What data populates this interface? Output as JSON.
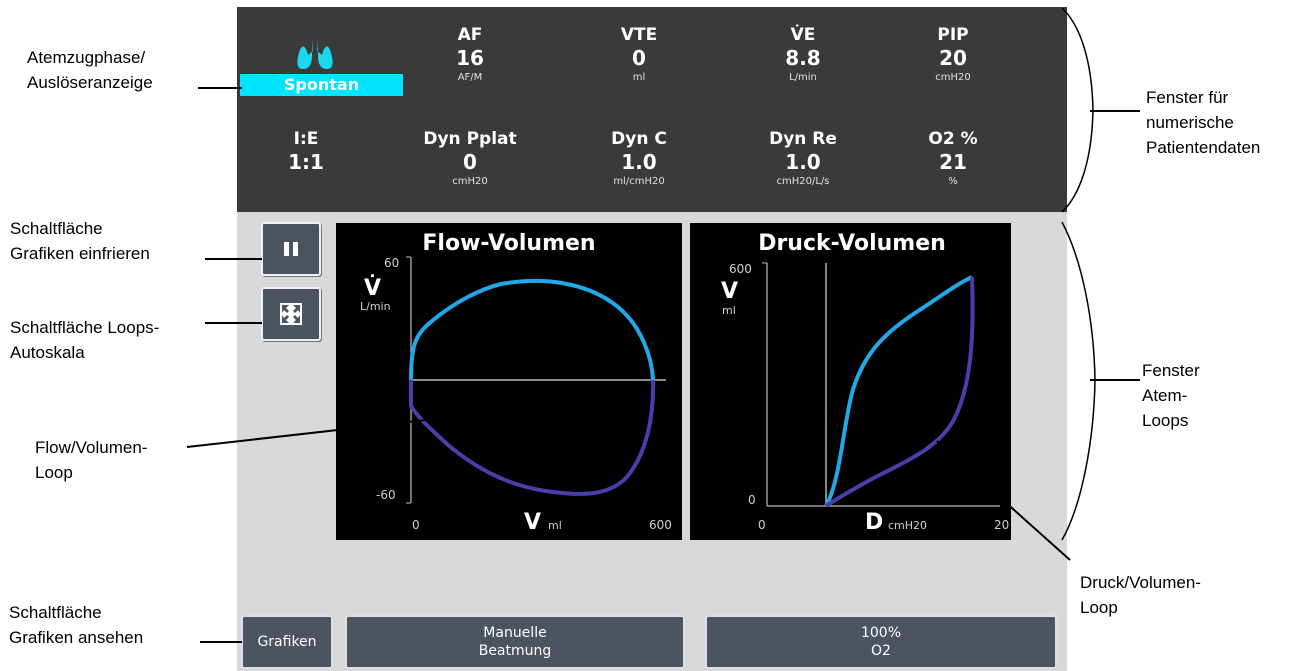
{
  "callouts": {
    "phase_indicator": "Atemzugphase/\nAuslöseranzeige",
    "patient_data_window": "Fenster für\nnumerische\nPatientendaten",
    "freeze_button": "Schaltfläche\nGrafiken einfrieren",
    "autoscale_button": "Schaltfläche Loops-\nAutoskala",
    "flow_volume_loop": "Flow/Volumen-\nLoop",
    "loops_window": "Fenster\nAtem-\nLoops",
    "pressure_volume_loop": "Druck/Volumen-\nLoop",
    "view_graphics_button": "Schaltfläche\nGrafiken ansehen"
  },
  "phase_label": "Spontan",
  "parameters_row1": [
    {
      "label": "AF",
      "value": "16",
      "unit": "AF/M"
    },
    {
      "label": "VTE",
      "value": "0",
      "unit": "ml"
    },
    {
      "label": "V̇E",
      "value": "8.8",
      "unit": "L/min"
    },
    {
      "label": "PIP",
      "value": "20",
      "unit": "cmH20"
    }
  ],
  "parameters_row2": [
    {
      "label": "I:E",
      "value": "1:1",
      "unit": ""
    },
    {
      "label": "Dyn Pplat",
      "value": "0",
      "unit": "cmH20"
    },
    {
      "label": "Dyn C",
      "value": "1.0",
      "unit": "ml/cmH20"
    },
    {
      "label": "Dyn Re",
      "value": "1.0",
      "unit": "cmH20/L/s"
    },
    {
      "label": "O2 %",
      "value": "21",
      "unit": "%"
    }
  ],
  "flow_volume": {
    "title": "Flow-Volumen",
    "y_symbol": "V̇",
    "y_unit": "L/min",
    "y_max": "60",
    "y_min": "-60",
    "x_symbol": "V",
    "x_unit": "ml",
    "x_min": "0",
    "x_max": "600"
  },
  "pressure_volume": {
    "title": "Druck-Volumen",
    "y_symbol": "V",
    "y_unit": "ml",
    "y_max": "600",
    "y_min": "0",
    "x_symbol": "D",
    "x_unit": "cmH20",
    "x_min": "0",
    "x_max": "20"
  },
  "buttons": {
    "graphics": "Grafiken",
    "manual_line1": "Manuelle",
    "manual_line2": "Beatmung",
    "o2_line1": "100%",
    "o2_line2": "O2"
  },
  "colors": {
    "inspiration": "#1fa9e6",
    "expiration": "#4a3ea8",
    "phase_badge": "#00e5ff",
    "panel": "#3a3a3a"
  }
}
